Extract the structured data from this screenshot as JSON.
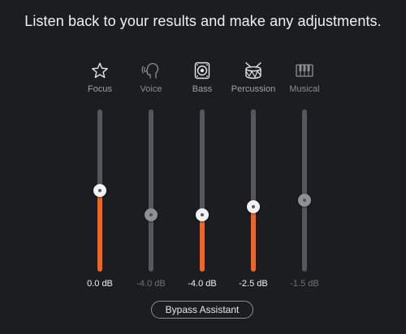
{
  "headline": "Listen back to your results and make any adjustments.",
  "colors": {
    "background": "#1c1d20",
    "accent": "#f26422",
    "track": "#55575d"
  },
  "range_db": [
    -12,
    6
  ],
  "channels": [
    {
      "label": "Focus",
      "icon": "star-icon",
      "value_text": "0.0 dB",
      "value_db": 0.0,
      "level": 0.5,
      "active": true
    },
    {
      "label": "Voice",
      "icon": "voice-head-icon",
      "value_text": "-4.0 dB",
      "value_db": -4.0,
      "level": 0.35,
      "active": false
    },
    {
      "label": "Bass",
      "icon": "speaker-icon",
      "value_text": "-4.0 dB",
      "value_db": -4.0,
      "level": 0.35,
      "active": true
    },
    {
      "label": "Percussion",
      "icon": "drum-icon",
      "value_text": "-2.5 dB",
      "value_db": -2.5,
      "level": 0.4,
      "active": true
    },
    {
      "label": "Musical",
      "icon": "piano-icon",
      "value_text": "-1.5 dB",
      "value_db": -1.5,
      "level": 0.44,
      "active": false
    }
  ],
  "bypass_button": "Bypass Assistant"
}
